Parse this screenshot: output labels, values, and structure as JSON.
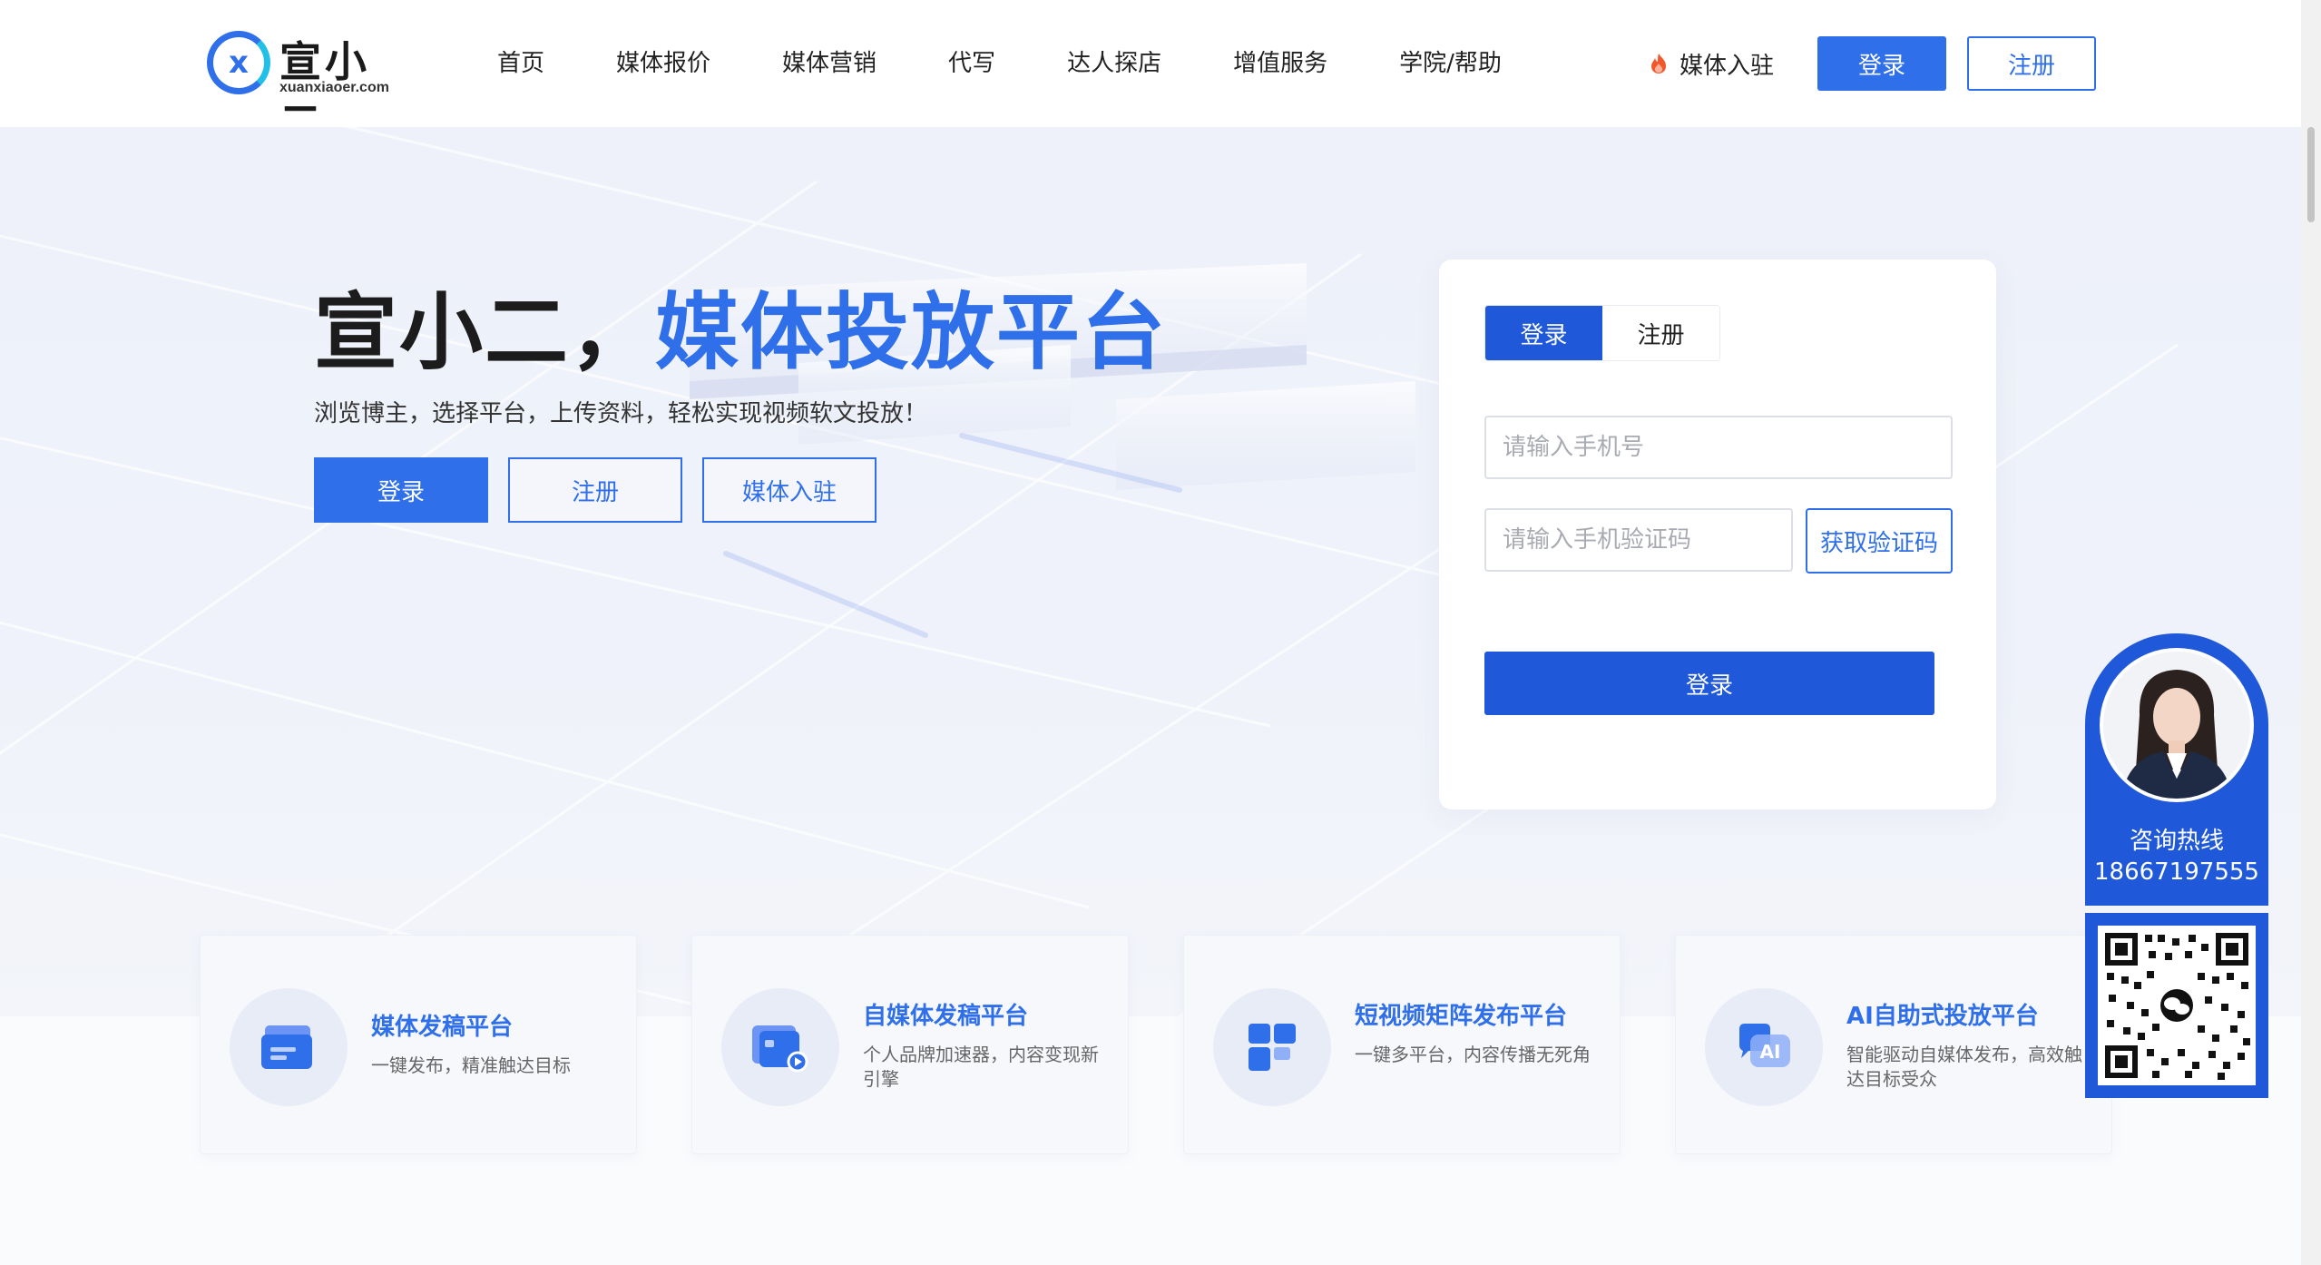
{
  "header": {
    "logo_name": "宣小二",
    "logo_domain": "xuanxiaoer.com",
    "nav": [
      "首页",
      "媒体报价",
      "媒体营销",
      "代写",
      "达人探店",
      "增值服务",
      "学院/帮助"
    ],
    "join_label": "媒体入驻",
    "login_label": "登录",
    "register_label": "注册"
  },
  "hero": {
    "title_part1": "宣小二，",
    "title_part2": "媒体投放平台",
    "subtitle": "浏览博主，选择平台，上传资料，轻松实现视频软文投放！",
    "btn_login": "登录",
    "btn_register": "注册",
    "btn_join": "媒体入驻"
  },
  "login_card": {
    "tab_login": "登录",
    "tab_register": "注册",
    "phone_placeholder": "请输入手机号",
    "code_placeholder": "请输入手机验证码",
    "get_code_label": "获取验证码",
    "submit_label": "登录"
  },
  "features": [
    {
      "title": "媒体发稿平台",
      "desc": "一键发布，精准触达目标",
      "icon": "card-icon"
    },
    {
      "title": "自媒体发稿平台",
      "desc": "个人品牌加速器，内容变现新引擎",
      "icon": "video-folder-icon"
    },
    {
      "title": "短视频矩阵发布平台",
      "desc": "一键多平台，内容传播无死角",
      "icon": "grid-icon"
    },
    {
      "title": "AI自助式投放平台",
      "desc": "智能驱动自媒体发布，高效触达目标受众",
      "icon": "ai-chat-icon"
    }
  ],
  "consult": {
    "label": "咨询热线",
    "phone": "18667197555"
  },
  "colors": {
    "primary": "#2f6fe9",
    "primary_dark": "#1f58d9"
  }
}
